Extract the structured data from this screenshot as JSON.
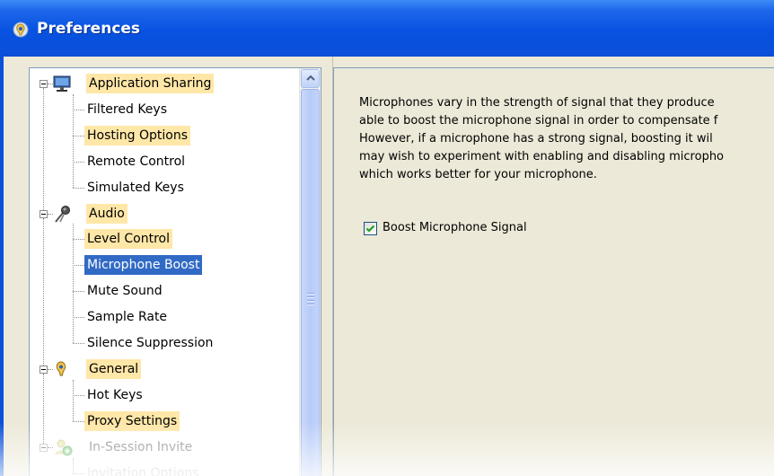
{
  "window": {
    "title": "Preferences",
    "icon": "app-logo-icon"
  },
  "tree": {
    "groups": [
      {
        "label": "Application Sharing",
        "icon": "monitor-icon",
        "highlighted": true,
        "children": [
          {
            "label": "Filtered Keys",
            "highlighted": false
          },
          {
            "label": "Hosting Options",
            "highlighted": true
          },
          {
            "label": "Remote Control",
            "highlighted": false
          },
          {
            "label": "Simulated Keys",
            "highlighted": false
          }
        ]
      },
      {
        "label": "Audio",
        "icon": "microphone-icon",
        "highlighted": true,
        "children": [
          {
            "label": "Level Control",
            "highlighted": true
          },
          {
            "label": "Microphone Boost",
            "selected": true
          },
          {
            "label": "Mute Sound",
            "highlighted": false
          },
          {
            "label": "Sample Rate",
            "highlighted": false
          },
          {
            "label": "Silence Suppression",
            "highlighted": false
          }
        ]
      },
      {
        "label": "General",
        "icon": "app-logo-icon",
        "highlighted": true,
        "children": [
          {
            "label": "Hot Keys",
            "highlighted": false
          },
          {
            "label": "Proxy Settings",
            "highlighted": true
          }
        ]
      },
      {
        "label": "In-Session Invite",
        "icon": "invite-user-icon",
        "highlighted": false,
        "children": [
          {
            "label": "Invitation Options",
            "highlighted": false
          }
        ]
      }
    ]
  },
  "content": {
    "description_lines": [
      "Microphones vary in the strength of signal that they produce",
      "able to boost the microphone signal in order to compensate f",
      "However, if a microphone has a strong signal, boosting it wil",
      "may wish to experiment with enabling and disabling micropho",
      "which works better for your microphone."
    ],
    "boost_checkbox": {
      "label": "Boost Microphone Signal",
      "checked": true
    }
  },
  "colors": {
    "titlebar": "#0a51d9",
    "highlight": "#ffe7a8",
    "selection": "#316ac5",
    "panel": "#ece9d8"
  }
}
